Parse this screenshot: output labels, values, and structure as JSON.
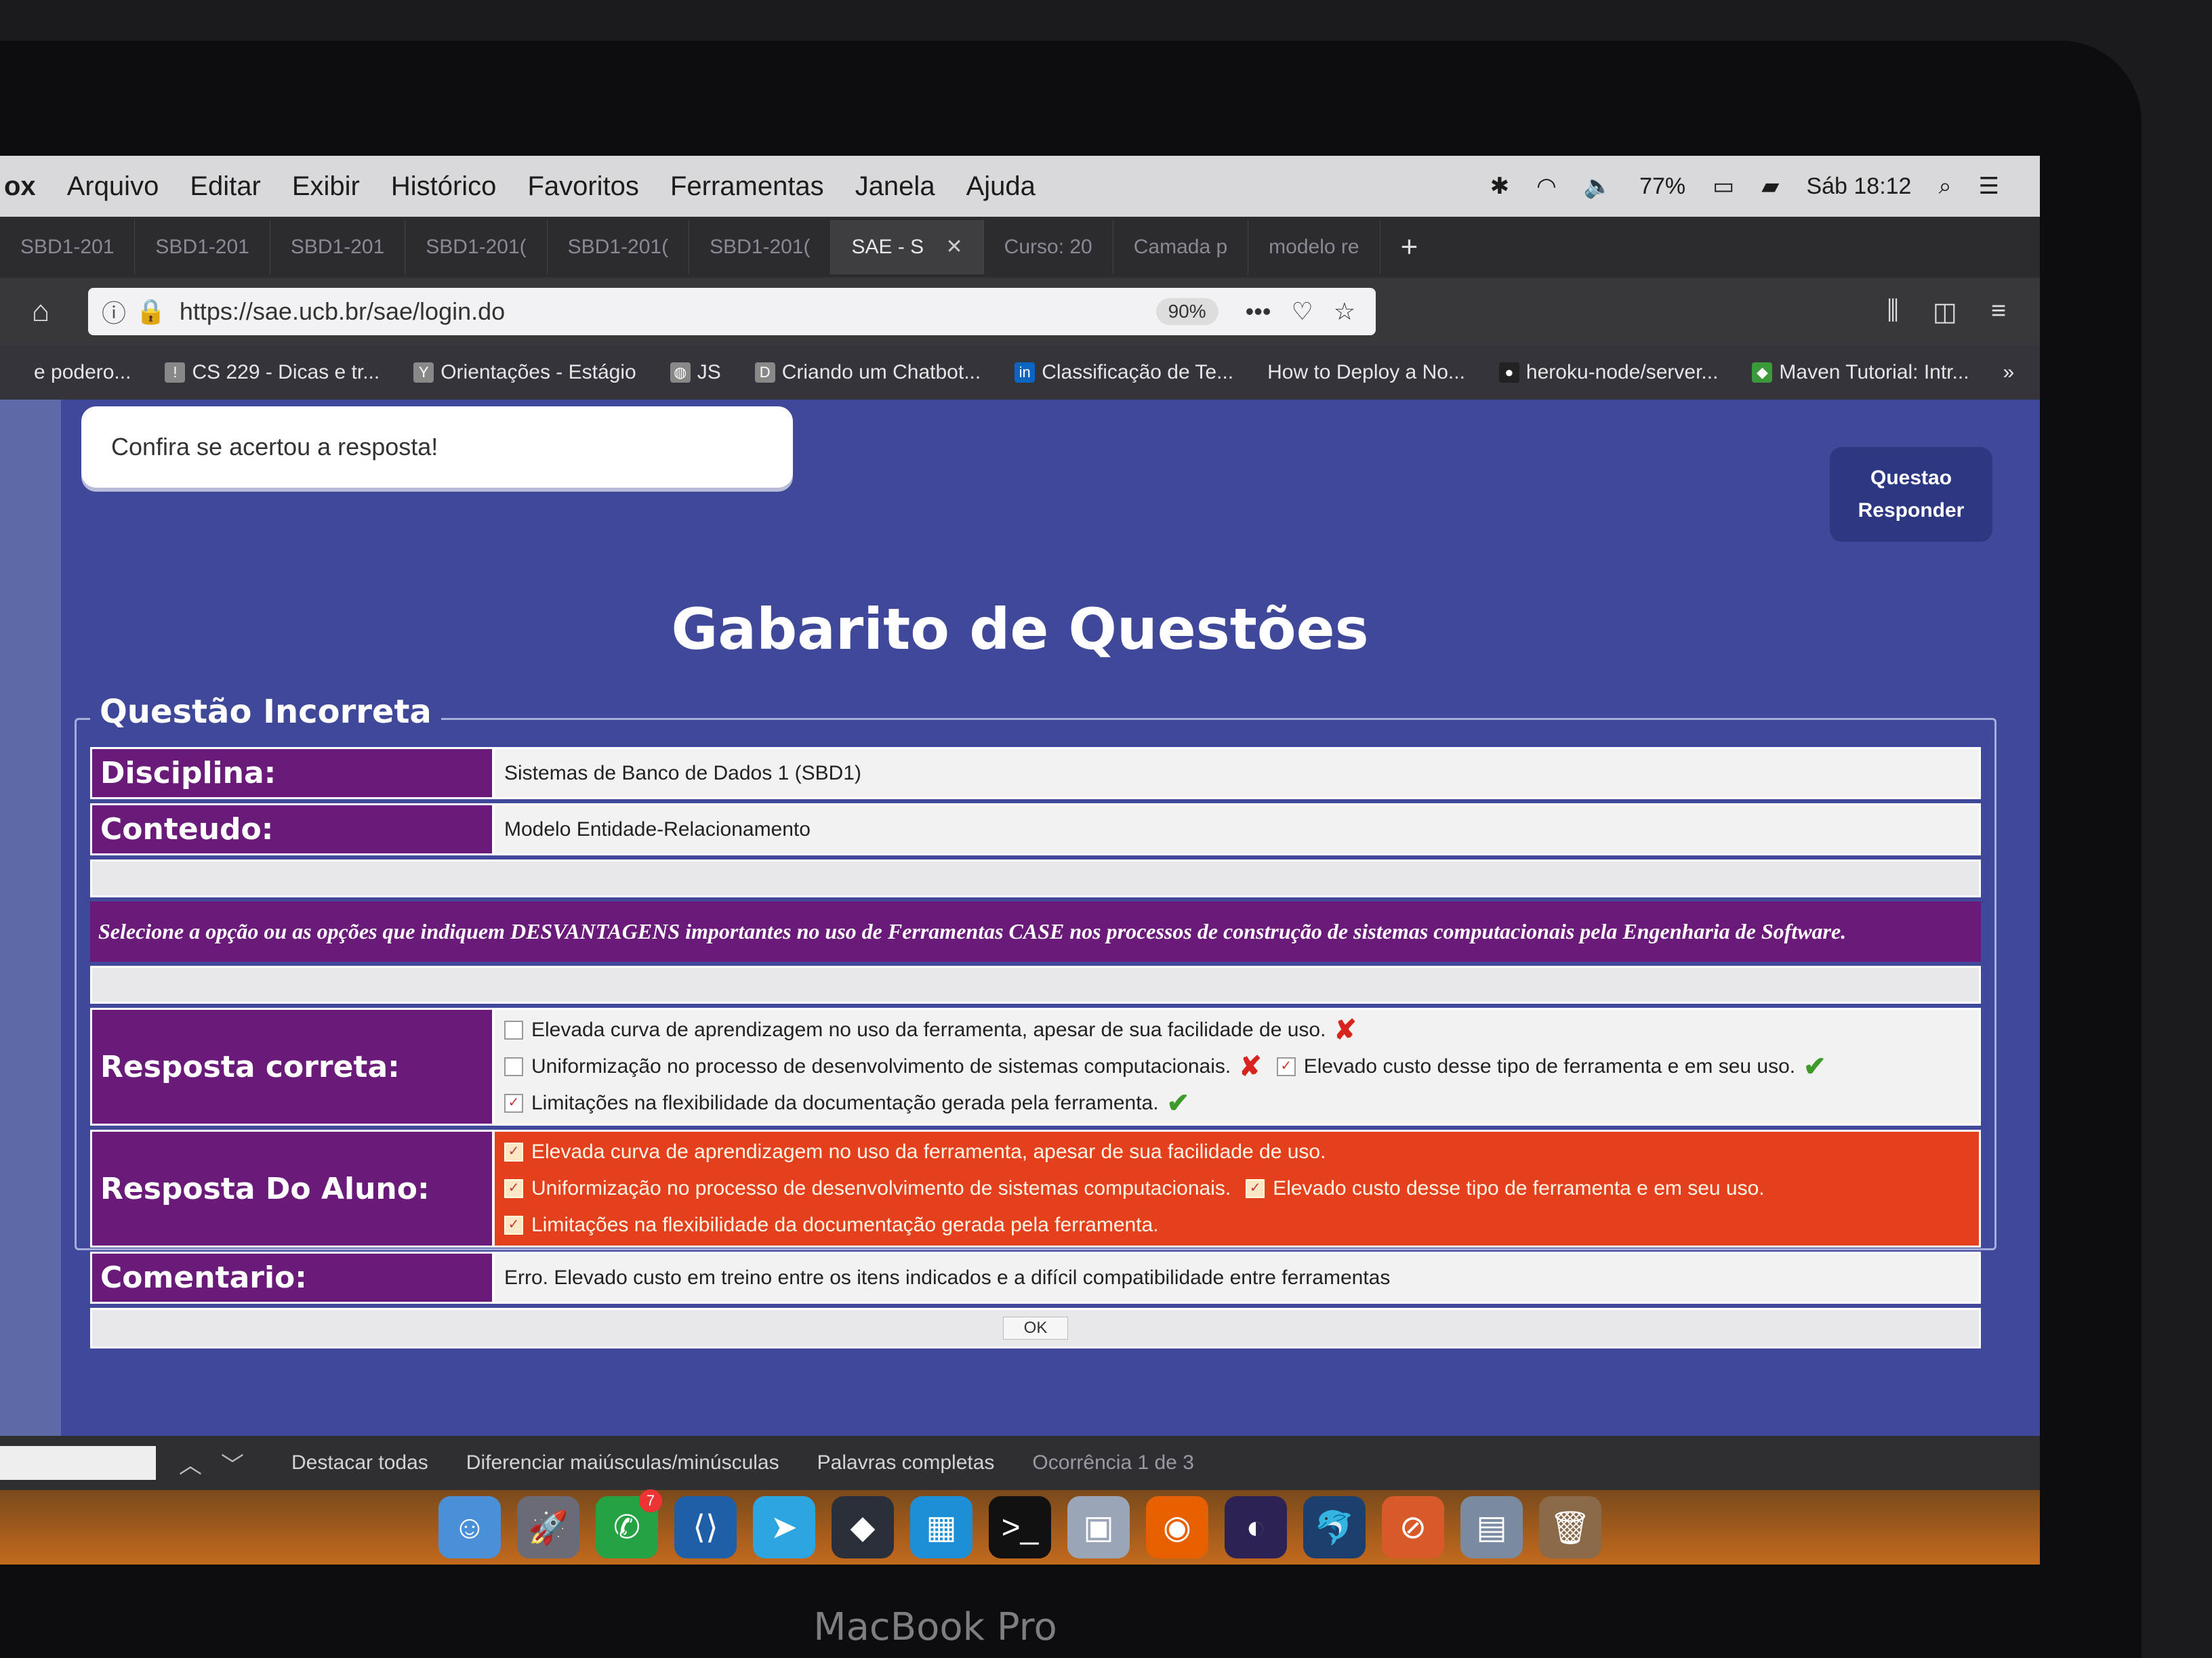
{
  "menubar": {
    "app": "ox",
    "items": [
      "Arquivo",
      "Editar",
      "Exibir",
      "Histórico",
      "Favoritos",
      "Ferramentas",
      "Janela",
      "Ajuda"
    ],
    "battery": "77%",
    "clock": "Sáb 18:12"
  },
  "tabs": [
    {
      "label": "SBD1-201"
    },
    {
      "label": "SBD1-201"
    },
    {
      "label": "SBD1-201"
    },
    {
      "label": "SBD1-201("
    },
    {
      "label": "SBD1-201("
    },
    {
      "label": "SBD1-201("
    },
    {
      "label": "SAE - S",
      "active": true
    },
    {
      "label": "Curso: 20"
    },
    {
      "label": "Camada p"
    },
    {
      "label": "modelo re"
    }
  ],
  "navbar": {
    "url": "https://sae.ucb.br/sae/login.do",
    "zoom": "90%"
  },
  "bookmarks": [
    {
      "label": "e podero..."
    },
    {
      "label": "CS 229 - Dicas e tr..."
    },
    {
      "label": "Orientações - Estágio"
    },
    {
      "label": "JS"
    },
    {
      "label": "Criando um Chatbot..."
    },
    {
      "label": "Classificação de Te..."
    },
    {
      "label": "How to Deploy a No..."
    },
    {
      "label": "heroku-node/server..."
    },
    {
      "label": "Maven Tutorial: Intr..."
    }
  ],
  "page": {
    "notice": "Confira se acertou a resposta!",
    "side_buttons": {
      "questao": "Questao",
      "responder": "Responder"
    },
    "title": "Gabarito de Questões",
    "legend": "Questão Incorreta",
    "disciplina_label": "Disciplina:",
    "disciplina_value": "Sistemas de Banco de Dados 1 (SBD1)",
    "conteudo_label": "Conteudo:",
    "conteudo_value": "Modelo Entidade-Relacionamento",
    "prompt": "Selecione a opção ou as opções que indiquem DESVANTAGENS importantes no uso de Ferramentas CASE nos processos de construção de sistemas computacionais pela Engenharia de Software.",
    "correta_label": "Resposta correta:",
    "aluno_label": "Resposta Do Aluno:",
    "options": {
      "o1": "Elevada curva de aprendizagem no uso da ferramenta, apesar de sua facilidade de uso.",
      "o2": "Uniformização no processo de desenvolvimento de sistemas computacionais.",
      "o3": "Elevado custo desse tipo de ferramenta e em seu uso.",
      "o4": "Limitações na flexibilidade da documentação gerada pela ferramenta."
    },
    "correct_marks": {
      "o1": "✘",
      "o2": "✘",
      "o3": "✔",
      "o4": "✔"
    },
    "comentario_label": "Comentario:",
    "comentario_value": "Erro. Elevado custo em treino entre os itens indicados e a difícil compatibilidade entre ferramentas",
    "ok": "OK"
  },
  "findbar": {
    "highlight": "Destacar todas",
    "case": "Diferenciar maiúsculas/minúsculas",
    "whole": "Palavras completas",
    "count": "Ocorrência 1 de 3"
  },
  "dock": {
    "whatsapp_badge": "7"
  },
  "laptop": {
    "brand": "MacBook Pro"
  }
}
